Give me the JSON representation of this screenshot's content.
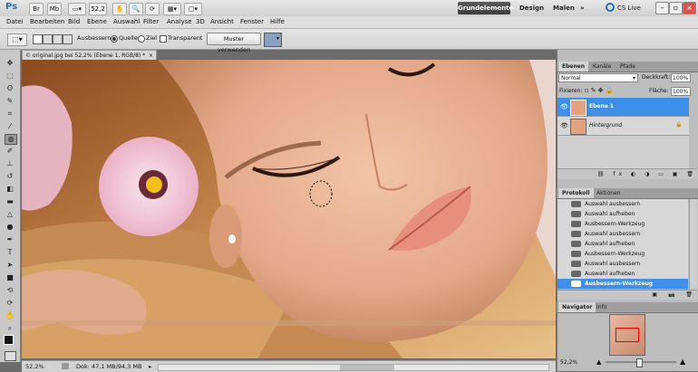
{
  "app": {
    "logo": "Ps"
  },
  "titlebar": {
    "br_label": "Br",
    "mb_label": "Mb",
    "zoom": "52,2",
    "workspaces": [
      "Grundelemente",
      "Design",
      "Malen"
    ],
    "cslive": "CS Live"
  },
  "menu": [
    "Datei",
    "Bearbeiten",
    "Bild",
    "Ebene",
    "Auswahl",
    "Filter",
    "Analyse",
    "3D",
    "Ansicht",
    "Fenster",
    "Hilfe"
  ],
  "options": {
    "ausbessern_label": "Ausbessern:",
    "quelle": "Quelle",
    "ziel": "Ziel",
    "transparent": "Transparent",
    "muster_button": "Muster verwenden"
  },
  "document": {
    "tab_title": "© original.jpg bei 52,2% (Ebene 1, RGB/8) *",
    "status_zoom": "52,2%",
    "status_doc": "Dok: 47,1 MB/94,3 MB"
  },
  "layers_panel": {
    "tabs": [
      "Ebenen",
      "Kanäle",
      "Pfade"
    ],
    "blend_mode": "Normal",
    "opacity_label": "Deckkraft:",
    "opacity_value": "100%",
    "fixieren_label": "Fixieren:",
    "fill_label": "Fläche:",
    "fill_value": "100%",
    "layers": [
      {
        "name": "Ebene 1",
        "selected": true
      },
      {
        "name": "Hintergrund",
        "selected": false
      }
    ]
  },
  "history_panel": {
    "tabs": [
      "Protokoll",
      "Aktionen"
    ],
    "items": [
      "Auswahl ausbessern",
      "Auswahl aufheben",
      "Ausbessern-Werkzeug",
      "Auswahl ausbessern",
      "Auswahl aufheben",
      "Ausbessern-Werkzeug",
      "Auswahl ausbessern",
      "Auswahl aufheben",
      "Ausbessern-Werkzeug"
    ],
    "selected_index": 8
  },
  "navigator_panel": {
    "tabs": [
      "Navigator",
      "Info"
    ],
    "zoom": "52,2%"
  },
  "colors": {
    "selection_blue": "#3d8fe8",
    "active_workspace": "#454545"
  }
}
